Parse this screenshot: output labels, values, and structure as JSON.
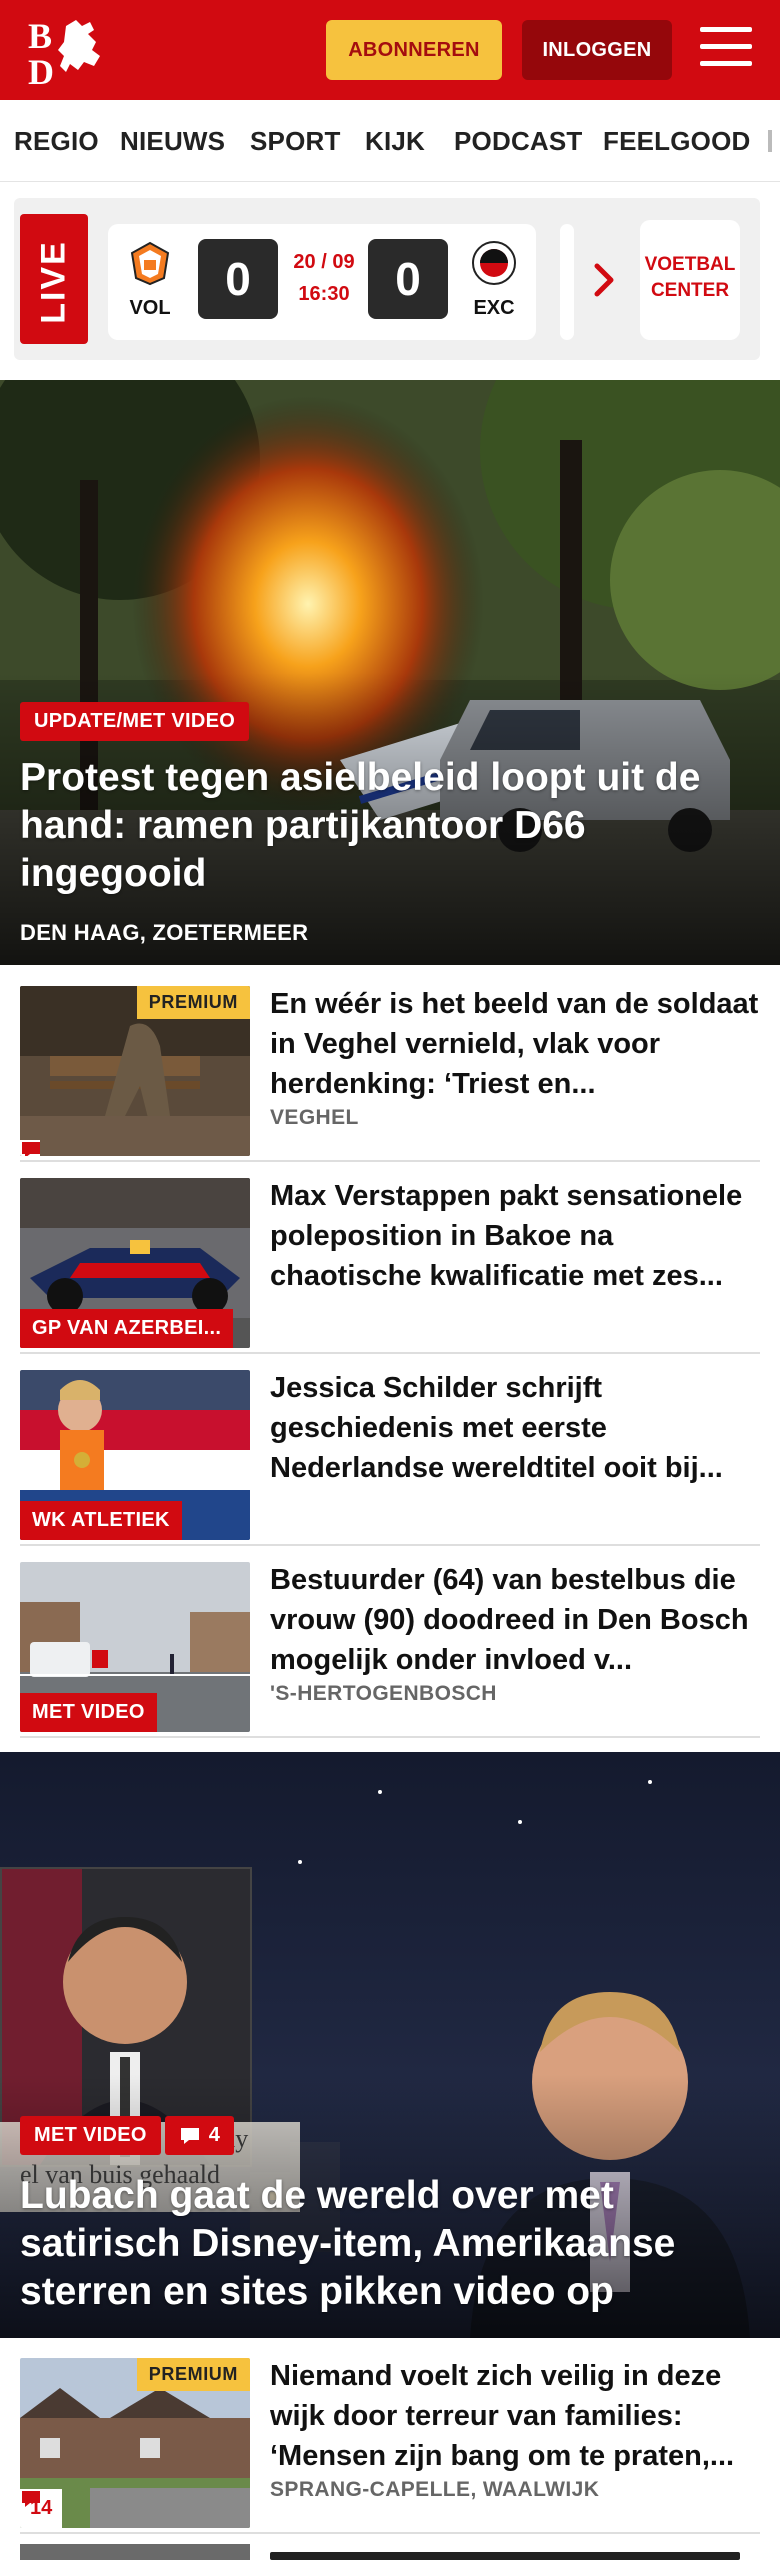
{
  "header": {
    "logo_text": "BD",
    "subscribe_label": "ABONNEREN",
    "login_label": "INLOGGEN",
    "menu_icon": "hamburger-icon",
    "brand_color": "#d10a11",
    "subscribe_color": "#f6c23e"
  },
  "nav": {
    "items": [
      "REGIO",
      "NIEUWS",
      "SPORT",
      "KIJK",
      "PODCAST",
      "FEELGOOD"
    ]
  },
  "live": {
    "tag": "LIVE",
    "home_team": "VOL",
    "home_score": "0",
    "away_team": "EXC",
    "away_score": "0",
    "date": "20 / 09",
    "time": "16:30",
    "center_label_1": "VOETBAL",
    "center_label_2": "CENTER"
  },
  "hero": {
    "label": "UPDATE/MET VIDEO",
    "title": "Protest tegen asielbeleid loopt uit de hand: ramen partijkantoor D66 ingegooid",
    "location": "DEN HAAG, ZOETERMEER"
  },
  "articles": [
    {
      "premium": "PREMIUM",
      "title": "En wéér is het beeld van de soldaat in Veghel vernield, vlak voor herdenking: ‘Triest en...",
      "location": "VEGHEL"
    },
    {
      "label": "GP VAN AZERBEI...",
      "title": "Max Verstappen pakt sensatione­le poleposition in Bakoe na chaotische kwalificatie met zes..."
    },
    {
      "label": "WK ATLETIEK",
      "title": "Jessica Schilder schrijft geschiedenis met eerste Nederlandse wereldtitel ooit bij..."
    },
    {
      "label": "MET VIDEO",
      "title": "Bestuurder (64) van bestelbus die vrouw (90) doodreed in Den Bosch mogelijk onder invloed v...",
      "location": "'S-HERTOGENBOSCH"
    }
  ],
  "hero2": {
    "label": "MET VIDEO",
    "comment_count": "4",
    "title": "Lubach gaat de wereld over met satirisch Disney-item, Amerikaanse sterren en sites pikken video op",
    "inset_overlay_text_1": "my",
    "inset_overlay_text_2": "el van buis gehaald"
  },
  "articles2": [
    {
      "premium": "PREMIUM",
      "comment_count": "14",
      "title": "Niemand voelt zich veilig in deze wijk door terreur van families: ‘Mensen zijn bang om te praten,...",
      "location": "SPRANG-CAPELLE, WAALWIJK"
    }
  ]
}
